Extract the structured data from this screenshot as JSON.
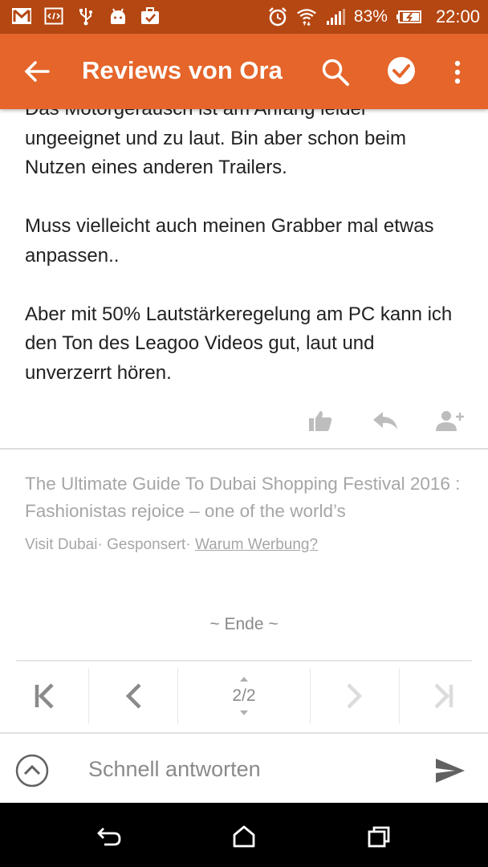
{
  "status_bar": {
    "battery_percent": "83%",
    "time": "22:00",
    "left_icons": [
      "gmail-icon",
      "code-icon",
      "usb-icon",
      "android-icon",
      "briefcase-check-icon"
    ],
    "right_icons": [
      "alarm-icon",
      "wifi-icon",
      "signal-icon",
      "battery-charging-icon"
    ]
  },
  "app_bar": {
    "title": "Reviews von Ora",
    "background": "#e5652a",
    "status_background": "#b54712"
  },
  "post": {
    "paragraphs": [
      "Das Motorgeräusch ist am Anfang leider ungeeignet und zu laut. Bin aber schon beim Nutzen eines anderen Trailers.",
      "Muss vielleicht auch meinen Grabber mal etwas anpassen..",
      "Aber mit 50% Lautstärkeregelung am PC kann ich den Ton des Leagoo Videos gut, laut und unverzerrt hören."
    ],
    "actions": [
      "like-icon",
      "reply-icon",
      "add-person-icon"
    ]
  },
  "ad": {
    "title": "The Ultimate Guide To Dubai Shopping Festival 2016 : Fashionistas rejoice – one of the world’s",
    "source": "Visit Dubai",
    "sponsored": "Gesponsert",
    "why_link": "Warum Werbung?"
  },
  "end_label": "~ Ende ~",
  "pager": {
    "page_label": "2/2",
    "current_page": 2,
    "total_pages": 2
  },
  "quick_reply": {
    "placeholder": "Schnell antworten"
  }
}
